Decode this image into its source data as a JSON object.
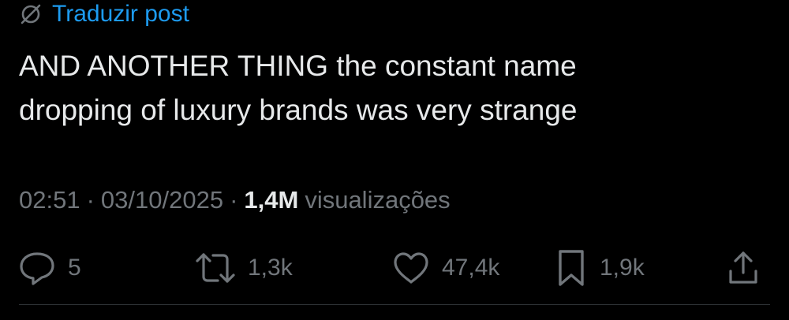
{
  "translate": {
    "icon": "globe-slash-icon",
    "label": "Traduzir post"
  },
  "post": {
    "lines": [
      "AND ANOTHER THING the constant name",
      "dropping of luxury brands was very strange"
    ]
  },
  "meta": {
    "time": "02:51",
    "separator": "·",
    "date": "03/10/2025",
    "views_count": "1,4M",
    "views_label": "visualizações"
  },
  "actions": {
    "replies": "5",
    "reposts": "1,3k",
    "likes": "47,4k",
    "bookmarks": "1,9k"
  },
  "colors": {
    "background": "#000000",
    "text_primary": "#e7e9ea",
    "text_secondary": "#71767b",
    "accent": "#1d9bf0",
    "divider": "#2f3336"
  }
}
